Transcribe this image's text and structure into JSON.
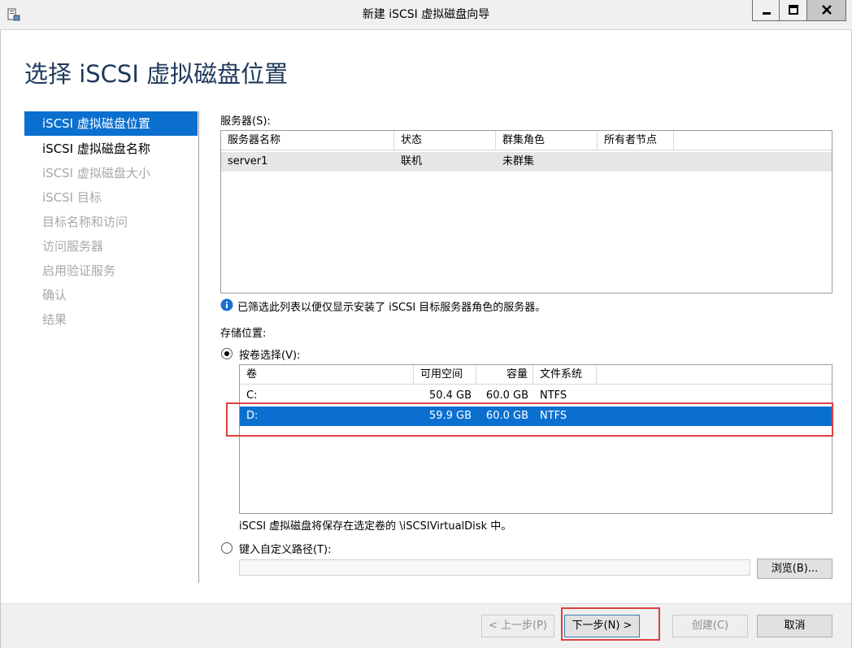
{
  "window": {
    "title": "新建 iSCSI 虚拟磁盘向导"
  },
  "page": {
    "heading": "选择 iSCSI 虚拟磁盘位置"
  },
  "nav": {
    "items": [
      {
        "label": "iSCSI 虚拟磁盘位置",
        "state": "selected"
      },
      {
        "label": "iSCSI 虚拟磁盘名称",
        "state": "enabled"
      },
      {
        "label": "iSCSI 虚拟磁盘大小",
        "state": "disabled"
      },
      {
        "label": "iSCSI 目标",
        "state": "disabled"
      },
      {
        "label": "目标名称和访问",
        "state": "disabled"
      },
      {
        "label": "访问服务器",
        "state": "disabled"
      },
      {
        "label": "启用验证服务",
        "state": "disabled"
      },
      {
        "label": "确认",
        "state": "disabled"
      },
      {
        "label": "结果",
        "state": "disabled"
      }
    ]
  },
  "servers": {
    "label": "服务器(S):",
    "columns": [
      "服务器名称",
      "状态",
      "群集角色",
      "所有者节点"
    ],
    "rows": [
      {
        "name": "server1",
        "status": "联机",
        "cluster_role": "未群集",
        "owner_node": ""
      }
    ],
    "info_text": "已筛选此列表以便仅显示安装了 iSCSI 目标服务器角色的服务器。"
  },
  "storage": {
    "label": "存储位置:",
    "by_volume_label": "按卷选择(V):",
    "by_volume_selected": true,
    "volume_columns": [
      "卷",
      "可用空间",
      "容量",
      "文件系统"
    ],
    "volumes": [
      {
        "volume": "C:",
        "free": "50.4 GB",
        "capacity": "60.0 GB",
        "fs": "NTFS",
        "selected": false
      },
      {
        "volume": "D:",
        "free": "59.9 GB",
        "capacity": "60.0 GB",
        "fs": "NTFS",
        "selected": true
      }
    ],
    "save_note": "iSCSI 虚拟磁盘将保存在选定卷的 \\iSCSIVirtualDisk 中。",
    "custom_path_label": "键入自定义路径(T):",
    "custom_path_value": "",
    "browse_label": "浏览(B)..."
  },
  "buttons": {
    "prev": "< 上一步(P)",
    "next": "下一步(N) >",
    "create": "创建(C)",
    "cancel": "取消"
  },
  "colors": {
    "selection": "#0a6fcf",
    "heading": "#1e395b",
    "highlight_box": "#e04040",
    "info_icon": "#1c6fd0"
  }
}
